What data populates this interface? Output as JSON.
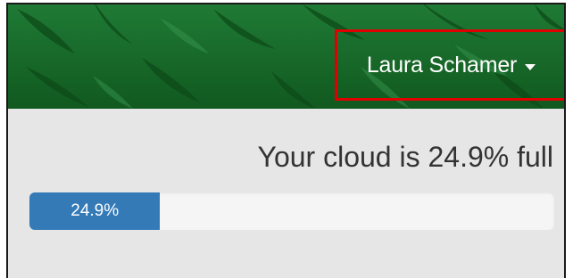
{
  "header": {
    "user_name": "Laura Schamer",
    "brand_color": "#176b2c",
    "highlight_color": "#e00000"
  },
  "storage": {
    "usage_text": "Your cloud is 24.9% full",
    "progress_label": "24.9%",
    "progress_fraction": 0.249,
    "bar_color": "#337ab7"
  },
  "icons": {
    "user_menu_caret": "chevron-down-icon"
  }
}
